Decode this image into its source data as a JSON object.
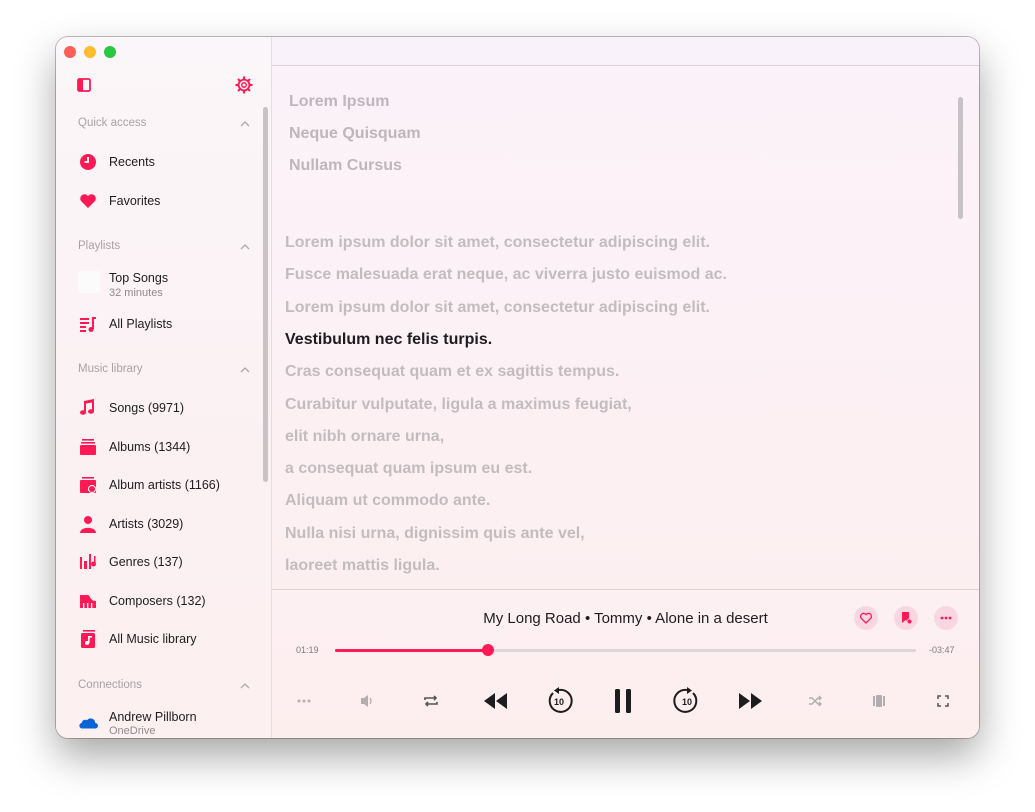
{
  "colors": {
    "accent": "#ff1a55",
    "text": "#1d1d1f",
    "muted": "#a8a1a5"
  },
  "sidebar": {
    "sections": {
      "quick_access": "Quick access",
      "playlists": "Playlists",
      "music_library": "Music library",
      "connections": "Connections"
    },
    "quick_access": [
      {
        "label": "Recents",
        "icon": "clock-icon"
      },
      {
        "label": "Favorites",
        "icon": "heart-icon"
      }
    ],
    "playlists": [
      {
        "label": "Top Songs",
        "sub": "32 minutes"
      },
      {
        "label": "All Playlists",
        "icon": "playlist-icon"
      }
    ],
    "library": [
      {
        "label": "Songs (9971)",
        "icon": "music-note-icon"
      },
      {
        "label": "Albums (1344)",
        "icon": "albums-icon"
      },
      {
        "label": "Album artists (1166)",
        "icon": "album-artist-icon"
      },
      {
        "label": "Artists (3029)",
        "icon": "person-icon"
      },
      {
        "label": "Genres (137)",
        "icon": "genres-icon"
      },
      {
        "label": "Composers (132)",
        "icon": "piano-icon"
      },
      {
        "label": "All Music library",
        "icon": "music-library-icon"
      }
    ],
    "connection": {
      "label": "Andrew Pillborn",
      "sub": "OneDrive"
    }
  },
  "credits": [
    "Lorem Ipsum",
    "Neque Quisquam",
    "Nullam Cursus"
  ],
  "lyrics": [
    "Lorem ipsum dolor sit amet, consectetur adipiscing elit.",
    "Fusce malesuada erat neque, ac viverra justo euismod ac.",
    "Lorem ipsum dolor sit amet, consectetur adipiscing elit.",
    "Vestibulum nec felis turpis.",
    "Cras consequat quam et ex sagittis tempus.",
    "Curabitur vulputate, ligula a maximus feugiat,",
    "elit nibh ornare urna,",
    "a consequat quam ipsum eu est.",
    "Aliquam ut commodo ante.",
    "Nulla nisi urna, dignissim quis ante vel,",
    "laoreet mattis ligula."
  ],
  "active_lyric_index": 3,
  "player": {
    "now_playing": "My Long Road • Tommy • Alone in a desert",
    "elapsed": "01:19",
    "remaining": "-03:47",
    "progress": 0.264,
    "skip_seconds_label": "10"
  }
}
